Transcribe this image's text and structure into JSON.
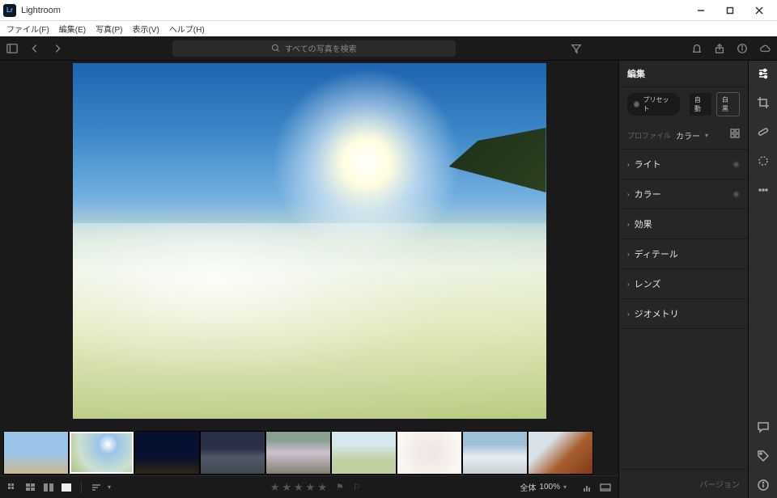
{
  "titlebar": {
    "app_name": "Lightroom"
  },
  "menubar": {
    "file": "ファイル(F)",
    "edit": "編集(E)",
    "photo": "写真(P)",
    "view": "表示(V)",
    "help": "ヘルプ(H)"
  },
  "search": {
    "placeholder": "すべての写真を検索"
  },
  "edit_panel": {
    "title": "編集",
    "preset": "プリセット",
    "auto": "自動",
    "bw": "白黒",
    "profile_label": "プロファイル",
    "profile_value": "カラー",
    "sections": {
      "light": "ライト",
      "color": "カラー",
      "effects": "効果",
      "detail": "ディテール",
      "lens": "レンズ",
      "geometry": "ジオメトリ"
    },
    "version": "バージョン"
  },
  "bottombar": {
    "zoom_label": "全体",
    "zoom_value": "100%"
  }
}
